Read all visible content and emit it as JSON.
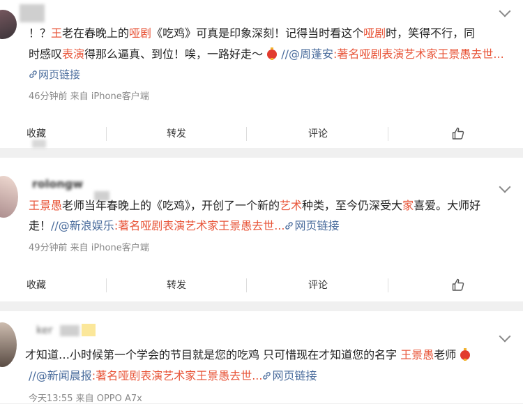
{
  "post1": {
    "line1": {
      "p1": "！？",
      "p2": "王",
      "p3": "老在春晚上的",
      "p4": "哑剧",
      "p5": "《吃鸡》可真是印象深刻！记得当时看这个",
      "p6": "哑剧",
      "p7": "时，笑得不行，同"
    },
    "line2": {
      "p1": "时感叹",
      "p2": "表演",
      "p3": "得那么逼真、到位！唉，一路好走～",
      "p4": "//",
      "p5": "@周蓬安",
      "p6": ":著名哑剧表演艺术家王景愚去世..."
    },
    "link_label": "网页链接",
    "meta": "46分钟前  来自 iPhone客户端"
  },
  "actions1": {
    "collect": "收藏",
    "forward": "转发",
    "comment": "评论"
  },
  "post2": {
    "username": "rolongw",
    "line1": {
      "p1": "王景愚",
      "p2": "老师当年春晚上的《吃鸡》，开创了一个新的",
      "p3": "艺术",
      "p4": "种类，至今仍深受大",
      "p5": "家",
      "p6": "喜爱。大师好"
    },
    "line2": {
      "p1": "走！",
      "p2": "//",
      "p3": "@新浪娱乐",
      "p4": ":著名哑剧表演艺术家王景愚去世...",
      "p5": "网页链接"
    },
    "meta": "49分钟前  来自 iPhone客户端"
  },
  "actions2": {
    "collect": "收藏",
    "forward": "转发",
    "comment": "评论"
  },
  "post3": {
    "username": "ker",
    "line1": {
      "p1": "才知道…小时候第一个学会的节目就是您的吃鸡 只可惜现在才知道您的名字 ",
      "p2": "王景愚",
      "p3": "老师"
    },
    "line2": {
      "p1": "//",
      "p2": "@新闻晨报",
      "p3": ":著名哑剧表演艺术家王景愚去世...",
      "p4": "网页链接"
    },
    "meta": "今天13:55  来自 OPPO A7x"
  },
  "colors": {
    "highlight": "#e8563a",
    "link": "#4a6c9c",
    "meta": "#888888",
    "divider": "#f0f0f0"
  },
  "icons": [
    "chevron-down-icon",
    "link-icon",
    "like-thumb-icon",
    "lantern-emoji-icon"
  ]
}
